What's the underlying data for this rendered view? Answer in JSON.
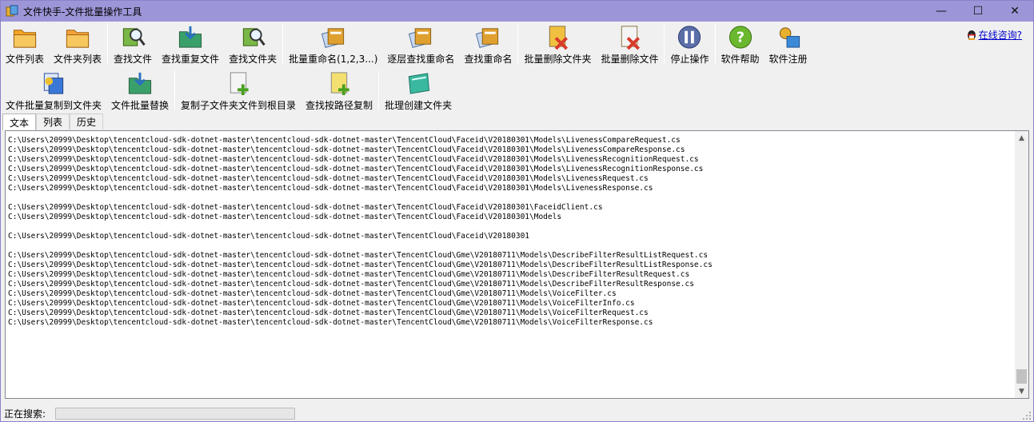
{
  "window": {
    "title": "文件快手-文件批量操作工具",
    "controls": [
      "—",
      "☐",
      "✕"
    ]
  },
  "toolbar1": [
    {
      "label": "文件列表",
      "icon": "folder-list-icon",
      "color": "#f5a623"
    },
    {
      "label": "文件夹列表",
      "icon": "folders-icon",
      "color": "#f2a33a"
    },
    {
      "label": "查找文件",
      "icon": "find-file-icon",
      "color": "#7ab648"
    },
    {
      "label": "查找重复文件",
      "icon": "find-duplicate-icon",
      "color": "#3aa06a"
    },
    {
      "label": "查找文件夹",
      "icon": "find-folder-icon",
      "color": "#7ab648"
    },
    {
      "label": "批量重命名(1,2,3...)",
      "icon": "batch-rename-icon",
      "color": "#e0a030"
    },
    {
      "label": "逐层查找重命名",
      "icon": "layer-rename-icon",
      "color": "#e0a030"
    },
    {
      "label": "查找重命名",
      "icon": "find-rename-icon",
      "color": "#e0a030"
    },
    {
      "label": "批量删除文件夹",
      "icon": "delete-folder-icon",
      "color": "#d83a2a"
    },
    {
      "label": "批量删除文件",
      "icon": "delete-file-icon",
      "color": "#d83a2a"
    },
    {
      "label": "停止操作",
      "icon": "pause-icon",
      "color": "#5a6ea8"
    },
    {
      "label": "软件帮助",
      "icon": "help-icon",
      "color": "#6ab82e"
    },
    {
      "label": "软件注册",
      "icon": "register-icon",
      "color": "#3a8ad8"
    }
  ],
  "help_link": "在线咨询?",
  "toolbar2": [
    {
      "label": "文件批量复制到文件夹",
      "icon": "batch-copy-icon",
      "color": "#3a78d8"
    },
    {
      "label": "文件批量替换",
      "icon": "batch-replace-icon",
      "color": "#3aa06a"
    },
    {
      "label": "复制子文件夹文件到根目录",
      "icon": "copy-to-root-icon",
      "color": "#6ab82e"
    },
    {
      "label": "查找按路径复制",
      "icon": "path-copy-icon",
      "color": "#e0c030"
    },
    {
      "label": "批理创建文件夹",
      "icon": "create-folder-icon",
      "color": "#3ab8a0"
    }
  ],
  "tabs": [
    "文本",
    "列表",
    "历史"
  ],
  "lines": [
    "C:\\Users\\20999\\Desktop\\tencentcloud-sdk-dotnet-master\\tencentcloud-sdk-dotnet-master\\TencentCloud\\Faceid\\V20180301\\Models\\LivenessCompareRequest.cs",
    "C:\\Users\\20999\\Desktop\\tencentcloud-sdk-dotnet-master\\tencentcloud-sdk-dotnet-master\\TencentCloud\\Faceid\\V20180301\\Models\\LivenessCompareResponse.cs",
    "C:\\Users\\20999\\Desktop\\tencentcloud-sdk-dotnet-master\\tencentcloud-sdk-dotnet-master\\TencentCloud\\Faceid\\V20180301\\Models\\LivenessRecognitionRequest.cs",
    "C:\\Users\\20999\\Desktop\\tencentcloud-sdk-dotnet-master\\tencentcloud-sdk-dotnet-master\\TencentCloud\\Faceid\\V20180301\\Models\\LivenessRecognitionResponse.cs",
    "C:\\Users\\20999\\Desktop\\tencentcloud-sdk-dotnet-master\\tencentcloud-sdk-dotnet-master\\TencentCloud\\Faceid\\V20180301\\Models\\LivenessRequest.cs",
    "C:\\Users\\20999\\Desktop\\tencentcloud-sdk-dotnet-master\\tencentcloud-sdk-dotnet-master\\TencentCloud\\Faceid\\V20180301\\Models\\LivenessResponse.cs",
    "",
    "C:\\Users\\20999\\Desktop\\tencentcloud-sdk-dotnet-master\\tencentcloud-sdk-dotnet-master\\TencentCloud\\Faceid\\V20180301\\FaceidClient.cs",
    "C:\\Users\\20999\\Desktop\\tencentcloud-sdk-dotnet-master\\tencentcloud-sdk-dotnet-master\\TencentCloud\\Faceid\\V20180301\\Models",
    "",
    "C:\\Users\\20999\\Desktop\\tencentcloud-sdk-dotnet-master\\tencentcloud-sdk-dotnet-master\\TencentCloud\\Faceid\\V20180301",
    "",
    "C:\\Users\\20999\\Desktop\\tencentcloud-sdk-dotnet-master\\tencentcloud-sdk-dotnet-master\\TencentCloud\\Gme\\V20180711\\Models\\DescribeFilterResultListRequest.cs",
    "C:\\Users\\20999\\Desktop\\tencentcloud-sdk-dotnet-master\\tencentcloud-sdk-dotnet-master\\TencentCloud\\Gme\\V20180711\\Models\\DescribeFilterResultListResponse.cs",
    "C:\\Users\\20999\\Desktop\\tencentcloud-sdk-dotnet-master\\tencentcloud-sdk-dotnet-master\\TencentCloud\\Gme\\V20180711\\Models\\DescribeFilterResultRequest.cs",
    "C:\\Users\\20999\\Desktop\\tencentcloud-sdk-dotnet-master\\tencentcloud-sdk-dotnet-master\\TencentCloud\\Gme\\V20180711\\Models\\DescribeFilterResultResponse.cs",
    "C:\\Users\\20999\\Desktop\\tencentcloud-sdk-dotnet-master\\tencentcloud-sdk-dotnet-master\\TencentCloud\\Gme\\V20180711\\Models\\VoiceFilter.cs",
    "C:\\Users\\20999\\Desktop\\tencentcloud-sdk-dotnet-master\\tencentcloud-sdk-dotnet-master\\TencentCloud\\Gme\\V20180711\\Models\\VoiceFilterInfo.cs",
    "C:\\Users\\20999\\Desktop\\tencentcloud-sdk-dotnet-master\\tencentcloud-sdk-dotnet-master\\TencentCloud\\Gme\\V20180711\\Models\\VoiceFilterRequest.cs",
    "C:\\Users\\20999\\Desktop\\tencentcloud-sdk-dotnet-master\\tencentcloud-sdk-dotnet-master\\TencentCloud\\Gme\\V20180711\\Models\\VoiceFilterResponse.cs"
  ],
  "status": {
    "label": "正在搜索:",
    "progress": 0
  }
}
